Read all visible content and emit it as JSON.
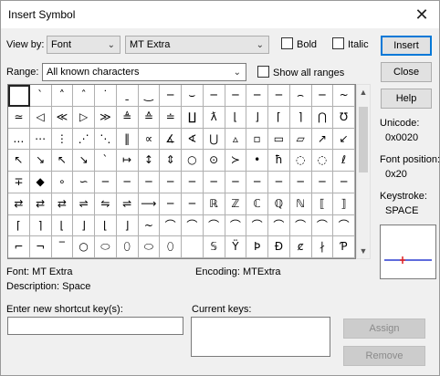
{
  "title": "Insert Symbol",
  "viewby": {
    "label": "View by:",
    "value": "Font"
  },
  "font": {
    "value": "MT Extra"
  },
  "options": {
    "bold": "Bold",
    "italic": "Italic",
    "show_all_ranges": "Show all ranges"
  },
  "range": {
    "label": "Range:",
    "value": "All known characters"
  },
  "buttons": {
    "insert": "Insert",
    "close": "Close",
    "help": "Help",
    "assign": "Assign",
    "remove": "Remove"
  },
  "info": {
    "unicode_label": "Unicode:",
    "unicode_value": "0x0020",
    "fontpos_label": "Font position:",
    "fontpos_value": "0x20",
    "keystroke_label": "Keystroke:",
    "keystroke_value": "SPACE"
  },
  "status": {
    "font": "Font: MT Extra",
    "encoding": "Encoding:  MTExtra",
    "description": "Description: Space"
  },
  "shortcut": {
    "label": "Enter new shortcut key(s):",
    "current_label": "Current keys:"
  },
  "colors": {
    "preview_line": "#2a3bd0",
    "preview_mark": "#e02020"
  },
  "grid_symbols": [
    " ",
    "ˋ",
    "˄",
    "ˆ",
    "˙",
    "ˍ",
    "‿",
    "─",
    "⌣",
    "─",
    "─",
    "─",
    "─",
    "⌢",
    "─",
    "~",
    "≃",
    "◁",
    "≪",
    "▷",
    "≫",
    "≜",
    "≙",
    "≐",
    "∐",
    "ƛ",
    "⌊",
    "⌋",
    "⌈",
    "⌉",
    "⋂",
    "℧",
    "…",
    "⋯",
    "⋮",
    "⋰",
    "⋱",
    "‖",
    "∝",
    "∡",
    "∢",
    "⋃",
    "▵",
    "▫",
    "▭",
    "▱",
    "↗",
    "↙",
    "↖",
    "↘",
    "↖",
    "↘",
    "ˋ",
    "↦",
    "↕",
    "⇕",
    "○",
    "⊙",
    "≻",
    "•",
    "ħ",
    "◌",
    "◌",
    "ℓ",
    "∓",
    "◆",
    "∘",
    "∽",
    "─",
    "─",
    "─",
    "─",
    "─",
    "─",
    "─",
    "─",
    "─",
    "─",
    "─",
    "─",
    "⇄",
    "⇄",
    "⇄",
    "⇌",
    "⇋",
    "⇌",
    "⟶",
    "─",
    "─",
    "ℝ",
    "ℤ",
    "ℂ",
    "ℚ",
    "ℕ",
    "⟦",
    "⟧",
    "⌈",
    "⌉",
    "⌊",
    "⌋",
    "⌊",
    "⌋",
    "~",
    "⌒",
    "⌒",
    "⌒",
    "⌒",
    "⌒",
    "⌒",
    "⌒",
    "⌒",
    "⌒",
    "⌐",
    "¬",
    "‾",
    "○",
    "⬭",
    "⬯",
    "⬭",
    "⬯",
    "",
    "𝕊",
    "Ÿ",
    "Þ",
    "Đ",
    "ȼ",
    "∤",
    "Ƥ"
  ]
}
